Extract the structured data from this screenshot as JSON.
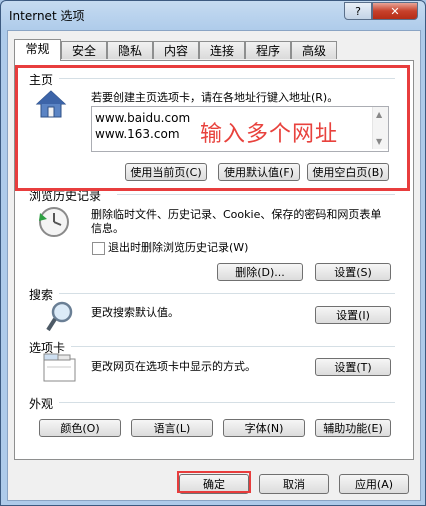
{
  "window": {
    "title": "Internet 选项",
    "help_label": "?",
    "close_label": "✕"
  },
  "tabs": [
    {
      "label": "常规"
    },
    {
      "label": "安全"
    },
    {
      "label": "隐私"
    },
    {
      "label": "内容"
    },
    {
      "label": "连接"
    },
    {
      "label": "程序"
    },
    {
      "label": "高级"
    }
  ],
  "home": {
    "group_label": "主页",
    "description": "若要创建主页选项卡，请在各地址行键入地址(R)。",
    "urls": [
      "www.baidu.com",
      "www.163.com"
    ],
    "annotation": "输入多个网址",
    "btn_current": "使用当前页(C)",
    "btn_default": "使用默认值(F)",
    "btn_blank": "使用空白页(B)"
  },
  "history": {
    "group_label": "浏览历史记录",
    "description": "删除临时文件、历史记录、Cookie、保存的密码和网页表单信息。",
    "checkbox_label": "退出时删除浏览历史记录(W)",
    "btn_delete": "删除(D)...",
    "btn_settings": "设置(S)"
  },
  "search": {
    "group_label": "搜索",
    "description": "更改搜索默认值。",
    "btn_settings": "设置(I)"
  },
  "tabs_group": {
    "group_label": "选项卡",
    "description": "更改网页在选项卡中显示的方式。",
    "btn_settings": "设置(T)"
  },
  "appearance": {
    "group_label": "外观",
    "btn_colors": "颜色(O)",
    "btn_languages": "语言(L)",
    "btn_fonts": "字体(N)",
    "btn_accessibility": "辅助功能(E)"
  },
  "footer": {
    "ok": "确定",
    "cancel": "取消",
    "apply": "应用(A)"
  }
}
